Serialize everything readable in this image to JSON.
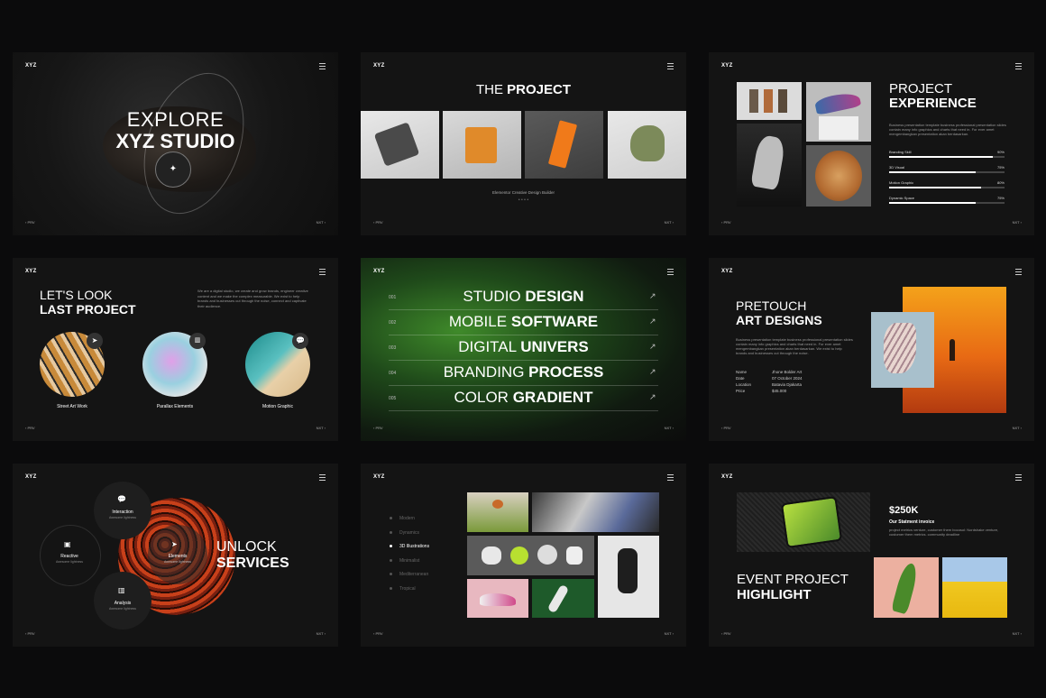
{
  "common": {
    "brand": "XYZ",
    "prev": "‹ PRV",
    "next": "NXT ›"
  },
  "s1": {
    "line1": "EXPLORE",
    "line2": "XYZ STUDIO"
  },
  "s2": {
    "title_thin": "THE",
    "title_bold": "PROJECT",
    "caption": "Elementor Creative Design Builder",
    "dots": "• • • •"
  },
  "s3": {
    "title_thin": "PROJECT",
    "title_bold": "EXPERIENCE",
    "desc": "Business presentation template business professional presentation slides contain many info graphics and charts that need in. For ever amet mengembangkan presentation akan berdasarkan.",
    "skills": [
      {
        "label": "Branding Skill",
        "pct": "90%",
        "value": 0.9
      },
      {
        "label": "3D Visual",
        "pct": "75%",
        "value": 0.75
      },
      {
        "label": "Motion Graphic",
        "pct": "80%",
        "value": 0.8
      },
      {
        "label": "Dynamic Space",
        "pct": "75%",
        "value": 0.75
      }
    ]
  },
  "s4": {
    "line1": "LET'S LOOK",
    "line2": "LAST PROJECT",
    "desc": "We are a digital studio, we create and grow brands, engineer creative content and we make the complex measurable. We exist to help brands and businesses cut through the noise, connect and captivate their audience.",
    "items": [
      {
        "label": "Street Art Work",
        "icon": "send-icon"
      },
      {
        "label": "Parallax Elements",
        "icon": "chart-icon"
      },
      {
        "label": "Motion Graphic",
        "icon": "chat-icon"
      }
    ]
  },
  "s5": {
    "rows": [
      {
        "num": "001",
        "thin": "STUDIO",
        "bold": "DESIGN"
      },
      {
        "num": "002",
        "thin": "MOBILE",
        "bold": "SOFTWARE"
      },
      {
        "num": "003",
        "thin": "DIGITAL",
        "bold": "UNIVERS"
      },
      {
        "num": "004",
        "thin": "BRANDING",
        "bold": "PROCESS"
      },
      {
        "num": "005",
        "thin": "COLOR",
        "bold": "GRADIENT"
      }
    ]
  },
  "s6": {
    "line1": "PRETOUCH",
    "line2": "ART DESIGNS",
    "desc": "Business presentation template business professional presentation slides contain many info graphics and charts that need in. For ever amet mengembangkan presentation akan berdasarkan. We exist to help brands and businesses cut through the noise.",
    "details": [
      {
        "key": "Name",
        "val": "Jhone Bolder Art"
      },
      {
        "key": "Date",
        "val": "07 October 2024"
      },
      {
        "key": "Location",
        "val": "Batavia Djakarta"
      },
      {
        "key": "Price",
        "val": "$45.000"
      }
    ]
  },
  "s7": {
    "line1": "UNLOCK",
    "line2": "SERVICES",
    "nodes": [
      {
        "title": "Interaction",
        "sub": "Awesome lightness",
        "icon": "chat-icon"
      },
      {
        "title": "Reactive",
        "sub": "Awesome lightness",
        "icon": "briefcase-icon"
      },
      {
        "title": "Elements",
        "sub": "Awesome lightness",
        "icon": "send-icon"
      },
      {
        "title": "Analysis",
        "sub": "Awesome lightness",
        "icon": "chart-icon"
      }
    ]
  },
  "s8": {
    "menu": [
      "Modern",
      "Dynamics",
      "3D Illustrations",
      "Minimalist",
      "Mediterranean",
      "Tropical"
    ],
    "active_index": 2
  },
  "s9": {
    "price": "$250K",
    "subtitle": "Our Statment invoice",
    "desc": "project metrics venture, customer them bocosol: Nordshake venture, customer them metrics. community deadline",
    "line1": "EVENT PROJECT",
    "line2": "HIGHLIGHT"
  }
}
